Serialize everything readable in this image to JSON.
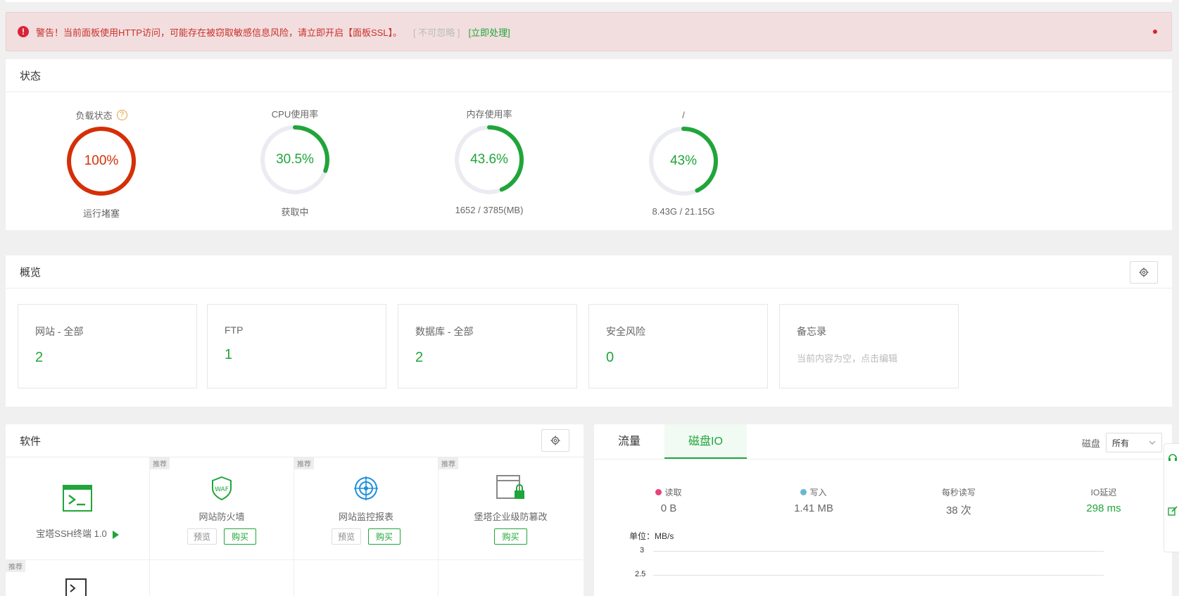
{
  "alert": {
    "icon": "exclamation-icon",
    "text": "警告！当前面板使用HTTP访问，可能存在被窃取敏感信息风险，请立即开启【面板SSL】。",
    "ignore": "[ 不可忽略 ]",
    "action": "[立即处理]"
  },
  "status": {
    "title": "状态",
    "gauges": [
      {
        "label": "负载状态",
        "value": "100%",
        "sub": "运行堵塞",
        "percent": 100,
        "color": "#d52f07"
      },
      {
        "label": "CPU使用率",
        "value": "30.5%",
        "sub": "获取中",
        "percent": 30.5,
        "color": "#20a53a"
      },
      {
        "label": "内存使用率",
        "value": "43.6%",
        "sub": "1652 / 3785(MB)",
        "percent": 43.6,
        "color": "#20a53a"
      },
      {
        "label": "/",
        "value": "43%",
        "sub": "8.43G / 21.15G",
        "percent": 43,
        "color": "#20a53a"
      }
    ]
  },
  "overview": {
    "title": "概览",
    "cards": [
      {
        "label": "网站 - 全部",
        "value": "2"
      },
      {
        "label": "FTP",
        "value": "1"
      },
      {
        "label": "数据库 - 全部",
        "value": "2"
      },
      {
        "label": "安全风险",
        "value": "0"
      },
      {
        "label": "备忘录",
        "memo": "当前内容为空，点击编辑"
      }
    ]
  },
  "software": {
    "title": "软件",
    "tag": "推荐",
    "items": [
      {
        "name": "宝塔SSH终端 1.0"
      },
      {
        "name": "网站防火墙",
        "preview": "预览",
        "buy": "购买"
      },
      {
        "name": "网站监控报表",
        "preview": "预览",
        "buy": "购买"
      },
      {
        "name": "堡塔企业级防篡改",
        "buy": "购买"
      }
    ]
  },
  "io": {
    "tabs": [
      "流量",
      "磁盘IO"
    ],
    "disk_label": "磁盘",
    "disk_value": "所有",
    "stats": [
      {
        "label": "读取",
        "value": "0 B",
        "color": "#e8417a"
      },
      {
        "label": "写入",
        "value": "1.41 MB",
        "color": "#6cb8cf"
      },
      {
        "label": "每秒读写",
        "value": "38 次"
      },
      {
        "label": "IO延迟",
        "value": "298 ms"
      }
    ],
    "chart_data": {
      "type": "line",
      "unit_label": "单位：MB/s",
      "yticks": [
        "3",
        "2.5"
      ],
      "series": []
    }
  }
}
